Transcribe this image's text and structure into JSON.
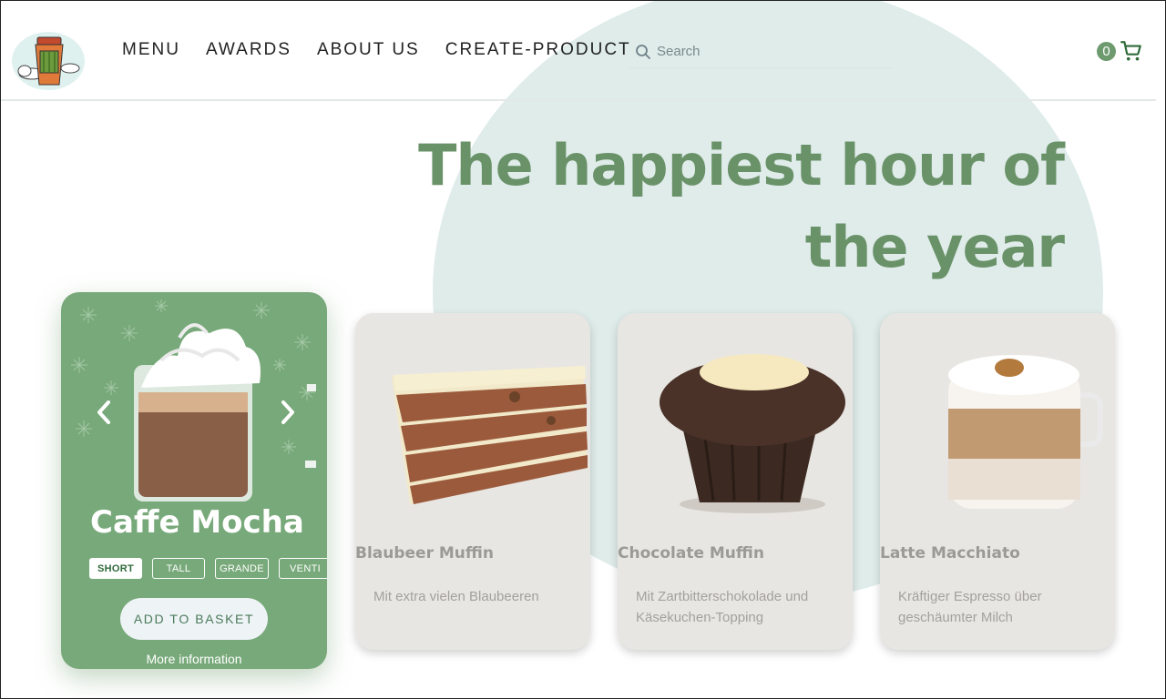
{
  "nav": {
    "items": [
      "MENU",
      "AWARDS",
      "ABOUT US",
      "CREATE-PRODUCT"
    ]
  },
  "search": {
    "placeholder": "Search",
    "icon": "search-icon"
  },
  "cart": {
    "count": "0",
    "icon": "shopping-cart-icon"
  },
  "hero": {
    "title": "The happiest hour of the year"
  },
  "featured": {
    "title": "Caffe Mocha",
    "sizes": [
      "SHORT",
      "TALL",
      "GRANDE",
      "VENTI"
    ],
    "selected_size": "SHORT",
    "add_to_basket": "ADD TO BASKET",
    "more_info": "More information"
  },
  "products": [
    {
      "title": "Blaubeer Muffin",
      "description": "Mit extra vielen Blaubeeren"
    },
    {
      "title": "Chocolate Muffin",
      "description": "Mit Zartbitterschokolade und Käsekuchen-Topping"
    },
    {
      "title": "Latte Macchiato",
      "description": "Kräftiger Espresso über geschäumter Milch"
    }
  ],
  "colors": {
    "brand_green": "#6a9269",
    "card_green": "#78a97a",
    "circle_bg": "#dfecea",
    "card_bg": "#e8e6e2"
  }
}
